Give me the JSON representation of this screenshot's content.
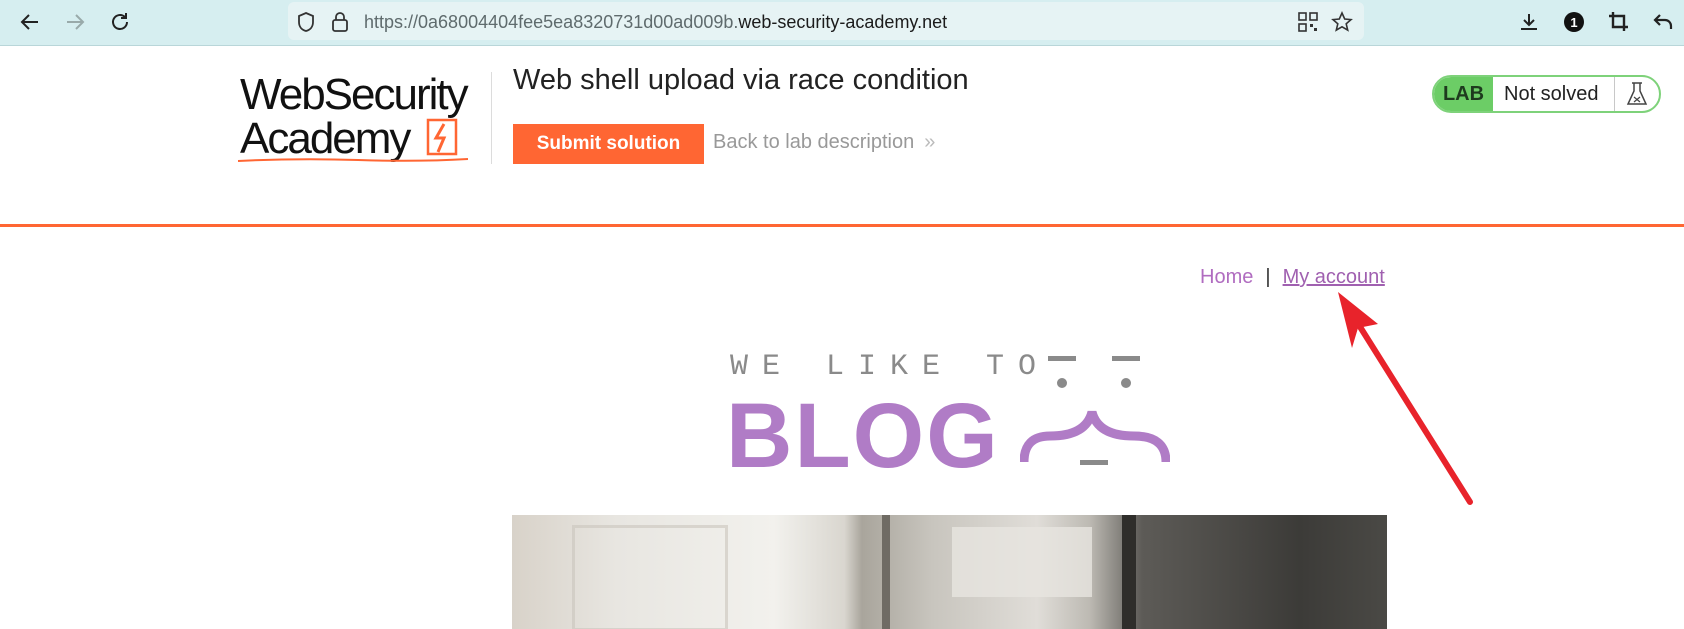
{
  "browser": {
    "url_prefix": "https://0a68004404fee5ea8320731d00ad009b.",
    "url_domain": "web-security-academy.net",
    "extension_badge": "1"
  },
  "lab": {
    "logo_line1": "WebSecurity",
    "logo_line2": "Academy",
    "title": "Web shell upload via race condition",
    "submit_label": "Submit solution",
    "back_label": "Back to lab description",
    "badge_label": "LAB",
    "status": "Not solved"
  },
  "nav": {
    "home": "Home",
    "separator": "|",
    "my_account": "My account"
  },
  "blog_logo": {
    "top_text": "WE LIKE TO",
    "main_text": "BLOG"
  },
  "colors": {
    "accent_orange": "#ff6633",
    "lab_green": "#6ccd66",
    "blog_purple": "#b07cc6",
    "annotation_red": "#e8232b"
  }
}
